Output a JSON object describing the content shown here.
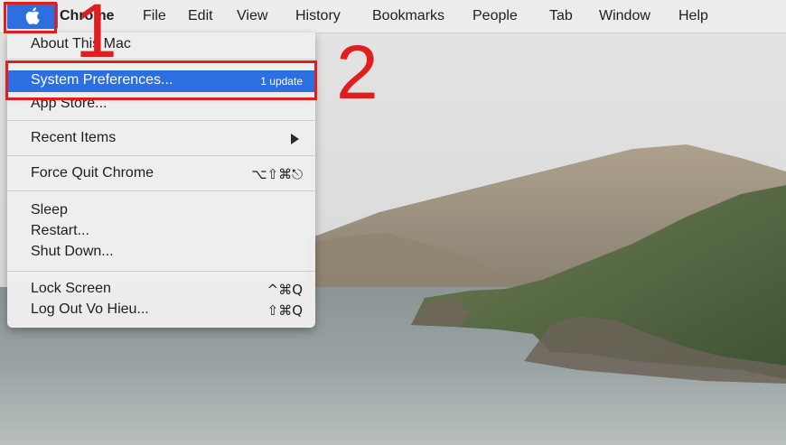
{
  "menubar": {
    "apple_icon": "apple-logo-icon",
    "app_name": "Chrome",
    "items": [
      "File",
      "Edit",
      "View",
      "History",
      "Bookmarks",
      "People",
      "Tab",
      "Window",
      "Help"
    ]
  },
  "apple_menu": {
    "about": "About This Mac",
    "system_prefs": {
      "label": "System Preferences...",
      "badge": "1 update"
    },
    "app_store": "App Store...",
    "recent_items": "Recent Items",
    "force_quit": {
      "label": "Force Quit Chrome",
      "shortcut": "⌥⇧⌘⎋"
    },
    "sleep": "Sleep",
    "restart": "Restart...",
    "shut_down": "Shut Down...",
    "lock_screen": {
      "label": "Lock Screen",
      "shortcut": "^⌘Q"
    },
    "log_out": {
      "label": "Log Out Vo Hieu...",
      "shortcut": "⇧⌘Q"
    }
  },
  "annotations": {
    "step1": "1",
    "step2": "2",
    "color": "#e01e1e"
  },
  "colors": {
    "highlight": "#2b6fe0",
    "menu_bg": "#eeeeee"
  }
}
